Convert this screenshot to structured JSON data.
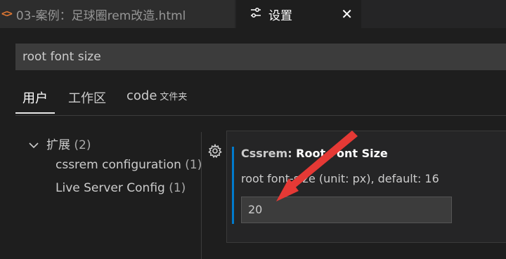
{
  "tabs": {
    "file_tab": {
      "label": "03-案例：足球圈rem改造.html",
      "icon": "code-brackets-icon"
    },
    "settings_tab": {
      "label": "设置",
      "icon": "settings-sliders-icon",
      "close_icon": "close-icon"
    }
  },
  "search": {
    "value": "root font size"
  },
  "scopes": {
    "user": "用户",
    "workspace": "工作区",
    "folder": {
      "label": "code",
      "sublabel": "文件夹"
    },
    "active": "user"
  },
  "tree": {
    "extensions": {
      "label": "扩展",
      "count": "(2)",
      "expanded": true
    },
    "items": [
      {
        "label": "cssrem configuration",
        "count": "(1)"
      },
      {
        "label": "Live Server Config",
        "count": "(1)"
      }
    ]
  },
  "setting": {
    "category": "Cssrem: ",
    "name": "Root Font Size",
    "description": "root font-size (unit: px), default: 16",
    "value": "20",
    "gear_icon": "gear-icon"
  },
  "colors": {
    "accent": "#007acc",
    "annotation_arrow": "#e53935",
    "file_icon": "#e37933"
  }
}
